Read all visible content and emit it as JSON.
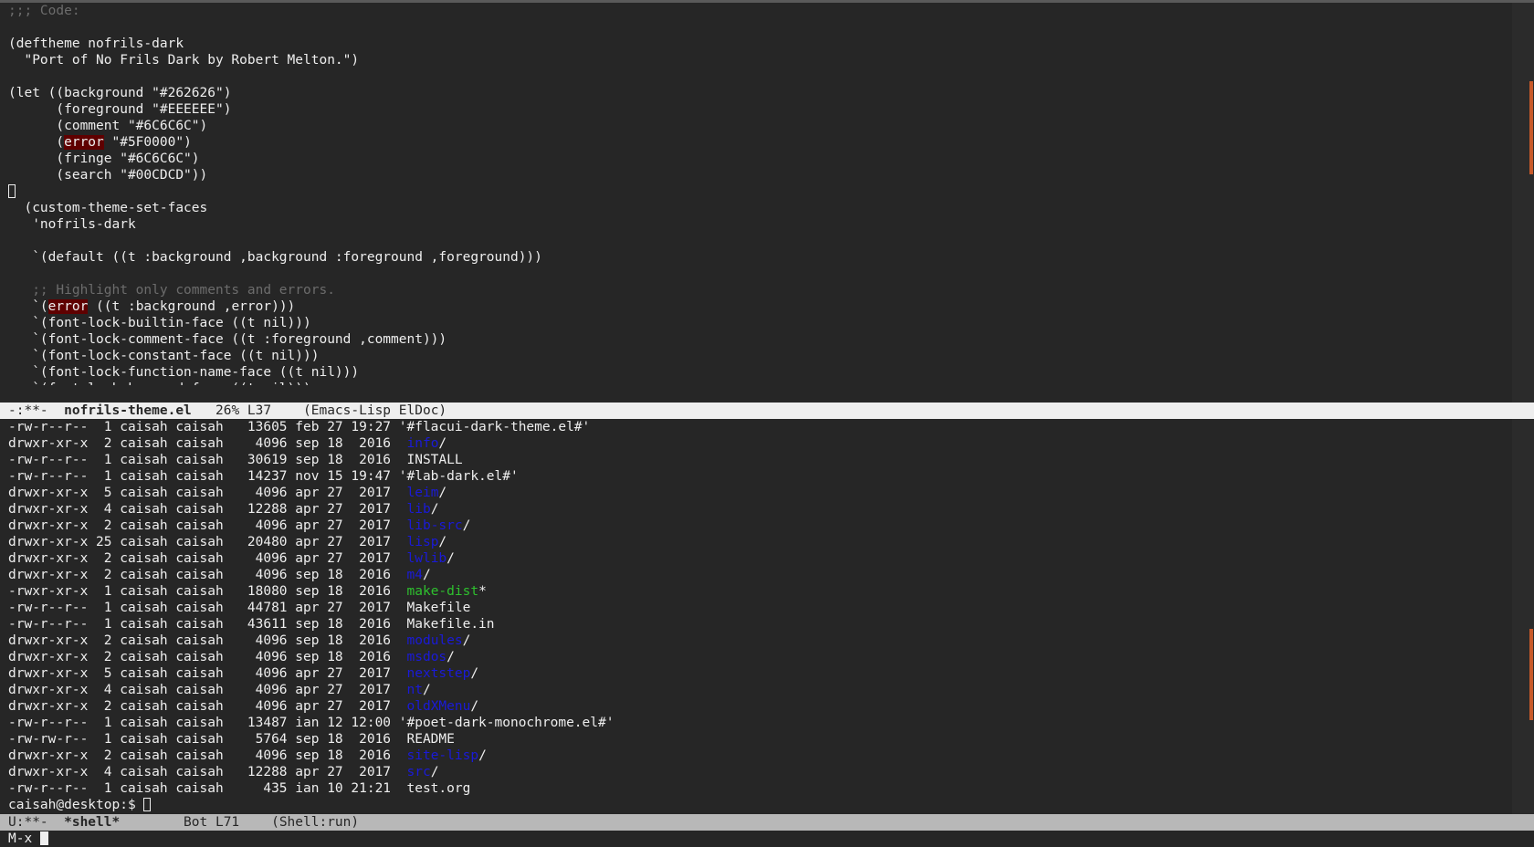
{
  "editor": {
    "lines": [
      [
        {
          "t": ";;; Code:",
          "c": "comment"
        }
      ],
      [
        {
          "t": ""
        }
      ],
      [
        {
          "t": "(deftheme nofrils-dark"
        }
      ],
      [
        {
          "t": "  \"Port of No Frils Dark by Robert Melton.\")"
        }
      ],
      [
        {
          "t": ""
        }
      ],
      [
        {
          "t": "(let ((background \"#262626\")"
        }
      ],
      [
        {
          "t": "      (foreground \"#EEEEEE\")"
        }
      ],
      [
        {
          "t": "      (comment \"#6C6C6C\")"
        }
      ],
      [
        {
          "t": "      ("
        },
        {
          "t": "error",
          "c": "err"
        },
        {
          "t": " \"#5F0000\")"
        }
      ],
      [
        {
          "t": "      (fringe \"#6C6C6C\")"
        }
      ],
      [
        {
          "t": "      (search \"#00CDCD\"))"
        }
      ],
      [
        {
          "t": "",
          "c": "cursor"
        }
      ],
      [
        {
          "t": "  (custom-theme-set-faces"
        }
      ],
      [
        {
          "t": "   'nofrils-dark"
        }
      ],
      [
        {
          "t": ""
        }
      ],
      [
        {
          "t": "   `(default ((t :background ,background :foreground ,foreground)))"
        }
      ],
      [
        {
          "t": ""
        }
      ],
      [
        {
          "t": "   ;; Highlight only comments and errors.",
          "c": "comment"
        }
      ],
      [
        {
          "t": "   `("
        },
        {
          "t": "error",
          "c": "err"
        },
        {
          "t": " ((t :background ,error)))"
        }
      ],
      [
        {
          "t": "   `(font-lock-builtin-face ((t nil)))"
        }
      ],
      [
        {
          "t": "   `(font-lock-comment-face ((t :foreground ,comment)))"
        }
      ],
      [
        {
          "t": "   `(font-lock-constant-face ((t nil)))"
        }
      ],
      [
        {
          "t": "   `(font-lock-function-name-face ((t nil)))"
        }
      ],
      [
        {
          "t": "   `(font-lock-keyword-face ((t nil)))",
          "clip": true
        }
      ]
    ]
  },
  "modeline_top": {
    "status": "-:**-  ",
    "buffer": "nofrils-theme.el",
    "rest": "   26% L37    (Emacs-Lisp ElDoc)"
  },
  "shell": {
    "lines": [
      [
        {
          "t": "-rw-r--r--  1 caisah caisah   13605 feb 27 19:27 '#flacui-dark-theme.el#'"
        }
      ],
      [
        {
          "t": "drwxr-xr-x  2 caisah caisah    4096 sep 18  2016  "
        },
        {
          "t": "info",
          "c": "dir"
        },
        {
          "t": "/"
        }
      ],
      [
        {
          "t": "-rw-r--r--  1 caisah caisah   30619 sep 18  2016  INSTALL"
        }
      ],
      [
        {
          "t": "-rw-r--r--  1 caisah caisah   14237 nov 15 19:47 '#lab-dark.el#'"
        }
      ],
      [
        {
          "t": "drwxr-xr-x  5 caisah caisah    4096 apr 27  2017  "
        },
        {
          "t": "leim",
          "c": "dir"
        },
        {
          "t": "/"
        }
      ],
      [
        {
          "t": "drwxr-xr-x  4 caisah caisah   12288 apr 27  2017  "
        },
        {
          "t": "lib",
          "c": "dir"
        },
        {
          "t": "/"
        }
      ],
      [
        {
          "t": "drwxr-xr-x  2 caisah caisah    4096 apr 27  2017  "
        },
        {
          "t": "lib-src",
          "c": "dir"
        },
        {
          "t": "/"
        }
      ],
      [
        {
          "t": "drwxr-xr-x 25 caisah caisah   20480 apr 27  2017  "
        },
        {
          "t": "lisp",
          "c": "dir"
        },
        {
          "t": "/"
        }
      ],
      [
        {
          "t": "drwxr-xr-x  2 caisah caisah    4096 apr 27  2017  "
        },
        {
          "t": "lwlib",
          "c": "dir"
        },
        {
          "t": "/"
        }
      ],
      [
        {
          "t": "drwxr-xr-x  2 caisah caisah    4096 sep 18  2016  "
        },
        {
          "t": "m4",
          "c": "dir"
        },
        {
          "t": "/"
        }
      ],
      [
        {
          "t": "-rwxr-xr-x  1 caisah caisah   18080 sep 18  2016  "
        },
        {
          "t": "make-dist",
          "c": "exec"
        },
        {
          "t": "*"
        }
      ],
      [
        {
          "t": "-rw-r--r--  1 caisah caisah   44781 apr 27  2017  Makefile"
        }
      ],
      [
        {
          "t": "-rw-r--r--  1 caisah caisah   43611 sep 18  2016  Makefile.in"
        }
      ],
      [
        {
          "t": "drwxr-xr-x  2 caisah caisah    4096 sep 18  2016  "
        },
        {
          "t": "modules",
          "c": "dir"
        },
        {
          "t": "/"
        }
      ],
      [
        {
          "t": "drwxr-xr-x  2 caisah caisah    4096 sep 18  2016  "
        },
        {
          "t": "msdos",
          "c": "dir"
        },
        {
          "t": "/"
        }
      ],
      [
        {
          "t": "drwxr-xr-x  5 caisah caisah    4096 apr 27  2017  "
        },
        {
          "t": "nextstep",
          "c": "dir"
        },
        {
          "t": "/"
        }
      ],
      [
        {
          "t": "drwxr-xr-x  4 caisah caisah    4096 apr 27  2017  "
        },
        {
          "t": "nt",
          "c": "dir"
        },
        {
          "t": "/"
        }
      ],
      [
        {
          "t": "drwxr-xr-x  2 caisah caisah    4096 apr 27  2017  "
        },
        {
          "t": "oldXMenu",
          "c": "dir"
        },
        {
          "t": "/"
        }
      ],
      [
        {
          "t": "-rw-r--r--  1 caisah caisah   13487 ian 12 12:00 '#poet-dark-monochrome.el#'"
        }
      ],
      [
        {
          "t": "-rw-rw-r--  1 caisah caisah    5764 sep 18  2016  README"
        }
      ],
      [
        {
          "t": "drwxr-xr-x  2 caisah caisah    4096 sep 18  2016  "
        },
        {
          "t": "site-lisp",
          "c": "dir"
        },
        {
          "t": "/"
        }
      ],
      [
        {
          "t": "drwxr-xr-x  4 caisah caisah   12288 apr 27  2017  "
        },
        {
          "t": "src",
          "c": "dir"
        },
        {
          "t": "/"
        }
      ],
      [
        {
          "t": "-rw-r--r--  1 caisah caisah     435 ian 10 21:21  test.org"
        }
      ]
    ],
    "prompt": "caisah@desktop:$ "
  },
  "modeline_bottom": {
    "status": "U:**-  ",
    "buffer": "*shell*",
    "rest": "        Bot L71    (Shell:run)"
  },
  "minibuffer": {
    "text": "M-x "
  },
  "colors": {
    "background": "#262626",
    "foreground": "#EEEEEE",
    "comment": "#6C6C6C",
    "error": "#5F0000",
    "directory": "#1a1ad8",
    "executable": "#2ec02e",
    "scrollbar_thumb": "#c85a2a"
  }
}
